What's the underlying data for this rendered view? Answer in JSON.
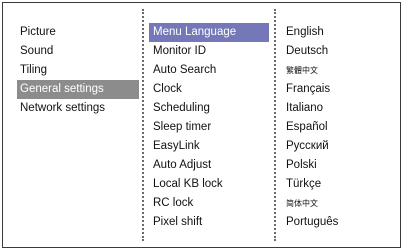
{
  "main_menu": {
    "items": [
      "Picture",
      "Sound",
      "Tiling",
      "General settings",
      "Network settings"
    ],
    "selected_index": 3
  },
  "submenu": {
    "items": [
      "Menu Language",
      "Monitor ID",
      "Auto Search",
      "Clock",
      "Scheduling",
      "Sleep timer",
      "EasyLink",
      "Auto Adjust",
      "Local KB lock",
      "RC lock",
      "Pixel shift"
    ],
    "selected_index": 0
  },
  "languages": {
    "items": [
      "English",
      "Deutsch",
      "繁體中文",
      "Français",
      "Italiano",
      "Español",
      "Русский",
      "Polski",
      "Türkçe",
      "简体中文",
      "Português"
    ]
  },
  "colors": {
    "selected_main": "#8c8c8c",
    "selected_sub": "#7478b8",
    "border": "#3a3a3a"
  }
}
